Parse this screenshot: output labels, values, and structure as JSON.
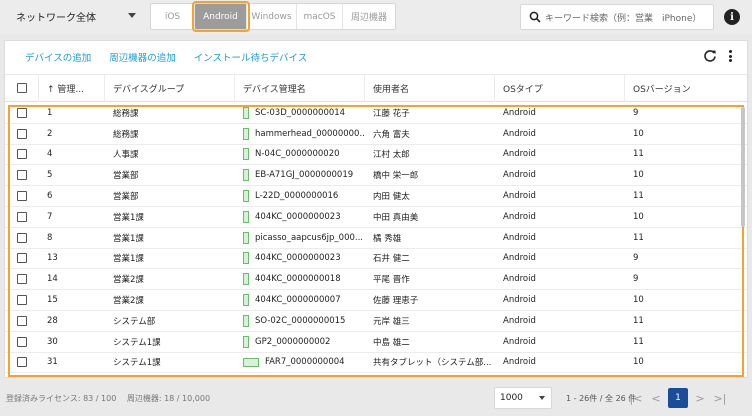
{
  "toolbar": {
    "network_select": "ネットワーク全体",
    "os_tabs": [
      "iOS",
      "Android",
      "Windows",
      "macOS",
      "周辺機器"
    ],
    "active_tab_index": 1,
    "search_placeholder": "キーワード検索（例：営業　iPhone）",
    "info_symbol": "i"
  },
  "actions": [
    "デバイスの追加",
    "周辺機器の追加",
    "インストール待ちデバイス"
  ],
  "table": {
    "columns": [
      "↑ 管理...",
      "デバイスグループ",
      "デバイス管理名",
      "使用者名",
      "OSタイプ",
      "OSバージョン"
    ],
    "rows": [
      {
        "id": "1",
        "group": "総務課",
        "name": "SC-03D_0000000014",
        "user": "江藤 花子",
        "os": "Android",
        "ver": "9",
        "icon": "phone"
      },
      {
        "id": "2",
        "group": "総務課",
        "name": "hammerhead_00000000...",
        "user": "六角 富夫",
        "os": "Android",
        "ver": "10",
        "icon": "phone"
      },
      {
        "id": "4",
        "group": "人事課",
        "name": "N-04C_0000000020",
        "user": "江村 太郎",
        "os": "Android",
        "ver": "11",
        "icon": "phone"
      },
      {
        "id": "5",
        "group": "営業部",
        "name": "EB-A71GJ_0000000019",
        "user": "橋中 栄一郎",
        "os": "Android",
        "ver": "10",
        "icon": "phone"
      },
      {
        "id": "6",
        "group": "営業部",
        "name": "L-22D_0000000016",
        "user": "内田 健太",
        "os": "Android",
        "ver": "11",
        "icon": "phone"
      },
      {
        "id": "7",
        "group": "営業1課",
        "name": "404KC_0000000023",
        "user": "中田 真由美",
        "os": "Android",
        "ver": "10",
        "icon": "phone"
      },
      {
        "id": "8",
        "group": "営業1課",
        "name": "picasso_aapcus6jp_000...",
        "user": "橘 秀雄",
        "os": "Android",
        "ver": "11",
        "icon": "phone"
      },
      {
        "id": "13",
        "group": "営業1課",
        "name": "404KC_0000000023",
        "user": "石井 健二",
        "os": "Android",
        "ver": "9",
        "icon": "phone"
      },
      {
        "id": "14",
        "group": "営業2課",
        "name": "404KC_0000000018",
        "user": "平尾 晋作",
        "os": "Android",
        "ver": "9",
        "icon": "phone"
      },
      {
        "id": "15",
        "group": "営業2課",
        "name": "404KC_0000000007",
        "user": "佐藤 理恵子",
        "os": "Android",
        "ver": "10",
        "icon": "phone"
      },
      {
        "id": "28",
        "group": "システム部",
        "name": "SO-02C_0000000015",
        "user": "元岸 雄三",
        "os": "Android",
        "ver": "11",
        "icon": "phone"
      },
      {
        "id": "30",
        "group": "システム1課",
        "name": "GP2_0000000002",
        "user": "中島 雄二",
        "os": "Android",
        "ver": "11",
        "icon": "phone"
      },
      {
        "id": "31",
        "group": "システム1課",
        "name": "FAR7_0000000004",
        "user": "共有タブレット（システム部...",
        "os": "Android",
        "ver": "10",
        "icon": "tablet"
      }
    ]
  },
  "footer": {
    "license": "登録済みライセンス: 83 / 100　 周辺機器: 18 / 10,000",
    "per_page": "1000",
    "range": "1 - 26件 / 全 26 件",
    "page": "1",
    "first_symbol": "|<",
    "prev_symbol": "<",
    "next_symbol": ">",
    "last_symbol": ">|"
  },
  "colors": {
    "accent": "#1e9bd7",
    "highlight": "#f0a530",
    "page_active": "#1a4d99",
    "device_icon": "#6cba6c"
  }
}
